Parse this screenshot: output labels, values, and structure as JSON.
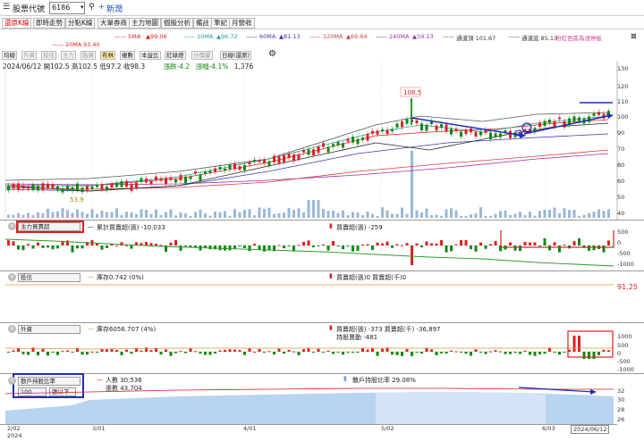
{
  "header": {
    "stock_code_label": "股票代號",
    "stock_code": "6186",
    "stock_name": "新潤"
  },
  "tabs": [
    {
      "label": "還原K線",
      "selected": true
    },
    {
      "label": "即時走勢"
    },
    {
      "label": "分點K線"
    },
    {
      "label": "大單券商"
    },
    {
      "label": "主力地圖"
    },
    {
      "label": "個股分析"
    },
    {
      "label": "備註"
    },
    {
      "label": "筆記"
    },
    {
      "label": "月營收"
    }
  ],
  "ma": {
    "ma5": "5MA",
    "ma5v": "▲99.06",
    "ma10": "10MA",
    "ma10v": "▲96.72",
    "ma60": "60MA",
    "ma60v": "▲81.13",
    "ma120": "120MA",
    "ma120v": "▲69.64",
    "ma240": "240MA",
    "ma240v": "▲59.13",
    "bull": "通道頂 101.67",
    "bear": "通道底 85.13",
    "ma20": "20MA",
    "ma20v": "93.40",
    "link": "粉紅色區為漲停板"
  },
  "toolbar": [
    "均線",
    "外資",
    "投信",
    "主力",
    "融資",
    "布林",
    "複數",
    "本益比",
    "紅綠燈",
    "分價量",
    "日線(還原)"
  ],
  "quote": {
    "date": "2024/06/12",
    "open_label": "開",
    "open": "102.5",
    "high_label": "高",
    "high": "102.5",
    "low_label": "低",
    "low": "97.2",
    "close_label": "收",
    "close": "98.3",
    "chg_label": "漲跌",
    "chg": "-4.2",
    "pct_label": "漲幅",
    "pct": "-4.1%",
    "vol": "1,376"
  },
  "price_chart": {
    "peak_label": "108.5",
    "low_label": "53.9"
  },
  "price_axis": [
    "130",
    "120",
    "110",
    "100",
    "90",
    "80",
    "70",
    "60",
    "50",
    "40"
  ],
  "panel_main": {
    "select": "主力買賣超",
    "cum_label": "累計買賣超(張) -10,033",
    "net_label": "買賣超(張) -259",
    "axis": [
      "500",
      "0",
      "-500",
      "-1000"
    ]
  },
  "panel_trust": {
    "select": "投信",
    "hold_label": "庫存0.742 (0%)",
    "net_label": "買賣超(張)0 買賣超(千)0",
    "axis_val": "91.25"
  },
  "panel_foreign": {
    "select": "外資",
    "hold_label": "庫存6056.707 (4%)",
    "net_label": "買賣超(張) -373 買賣超(千) -36,897",
    "diff_label": "持股異動 -481",
    "axis": [
      "1000",
      "500",
      "0",
      "-500",
      "-1000"
    ]
  },
  "panel_holder": {
    "select": "散戶持股比率",
    "people_label": "人數 30,536",
    "lots_label": "張數 43,704",
    "ratio_label": "散戶持股比率 29.08%",
    "threshold": "100",
    "btn": "張以下",
    "axis": [
      "32",
      "30",
      "28",
      "26"
    ]
  },
  "x_axis": [
    "2/02",
    "2024",
    "3/01",
    "4/01",
    "5/02",
    "6/03",
    "2024/06/12"
  ],
  "colors": {
    "up": "#e02020",
    "down": "#118811",
    "annotation": "#e02020",
    "arrow": "#1c2fb8"
  }
}
